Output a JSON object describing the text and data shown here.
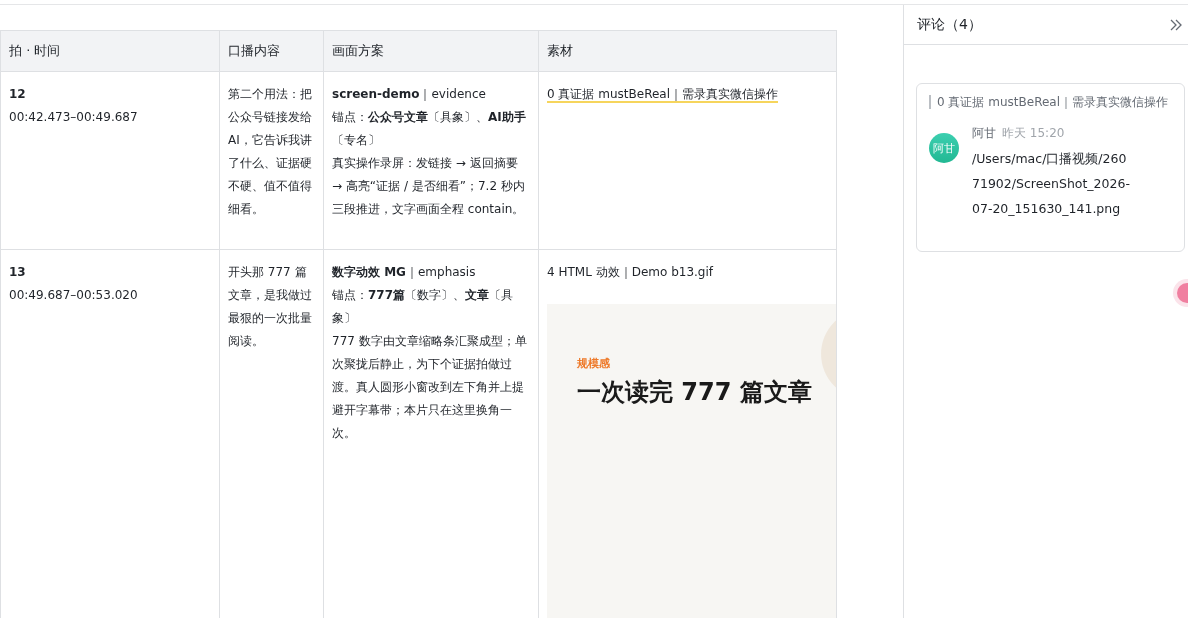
{
  "table": {
    "columns": [
      "拍 · 时间",
      "口播内容",
      "画面方案",
      "素材"
    ],
    "rows": [
      {
        "beat": "12",
        "time": "00:42.473–00:49.687",
        "script": "第二个用法：把公众号链接发给 AI，它告诉我讲了什么、证据硬不硬、值不值得细看。",
        "plan": [
          "**screen-demo**｜evidence",
          "锚点：**公众号文章**〔具象〕、**AI助手**〔专名〕",
          "真实操作录屏：发链接 → 返回摘要 → 高亮“证据 / 是否细看”；7.2 秒内三段推进，文字画面全程 contain。"
        ],
        "material": {
          "text": "0 真证据 mustBeReal｜需录真实微信操作",
          "commented": true
        }
      },
      {
        "beat": "13",
        "time": "00:49.687–00:53.020",
        "script": "开头那 777 篇文章，是我做过最狠的一次批量阅读。",
        "plan": [
          "**数字动效 MG**｜emphasis",
          "锚点：**777篇**〔数字〕、**文章**〔具象〕",
          "777 数字由文章缩略条汇聚成型；单次聚拢后静止，为下个证据拍做过渡。真人圆形小窗改到左下角并上提避开字幕带；本片只在这里换角一次。"
        ],
        "material": {
          "text": "4 HTML 动效｜Demo b13.gif",
          "commented": false,
          "preview": {
            "tag": "规模感",
            "headline": "一次读完 777 篇文章"
          }
        }
      }
    ]
  },
  "comments": {
    "title": "评论（4）",
    "items": [
      {
        "quote": "0 真证据 mustBeReal｜需录真实微信操作",
        "avatar": "阿甘",
        "author": "阿甘",
        "time": "昨天 15:20",
        "body": "/Users/mac/口播视频/26071902/ScreenShot_2026-07-20_151630_141.png"
      }
    ]
  }
}
